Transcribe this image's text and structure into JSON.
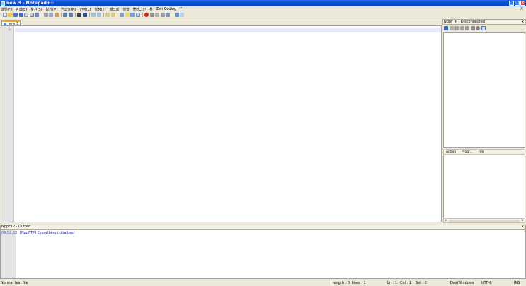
{
  "window": {
    "title": "new  3 - Notepad++"
  },
  "menu": [
    "파일(F)",
    "편집(E)",
    "찾기(S)",
    "보기(V)",
    "인코딩(N)",
    "언어(L)",
    "설정(T)",
    "매크로",
    "실행",
    "플러그인",
    "창",
    "Zen Coding",
    "?"
  ],
  "menu_close": "X",
  "tab": {
    "label": "new  3"
  },
  "editor": {
    "line_number": "1"
  },
  "ftp_panel": {
    "title": "NppFTP - Disconnected",
    "close": "x",
    "queue_columns": [
      "Action",
      "Progr...",
      "File"
    ]
  },
  "output": {
    "title": "NppFTP - Output",
    "close": "x",
    "time": "09:58:52",
    "message": "[NppFTP] Everything initialized"
  },
  "status": {
    "file_type": "Normal text file",
    "length": "length : 0",
    "lines": "lines : 1",
    "ln": "Ln : 1",
    "col": "Col : 1",
    "sel": "Sel : 0",
    "eol": "Dos\\Windows",
    "encoding": "UTF-8",
    "mode": "INS"
  },
  "colors": {
    "titlebar": "#0a50d8",
    "tab_accent": "#f0a030",
    "output_text": "#1010a0"
  }
}
